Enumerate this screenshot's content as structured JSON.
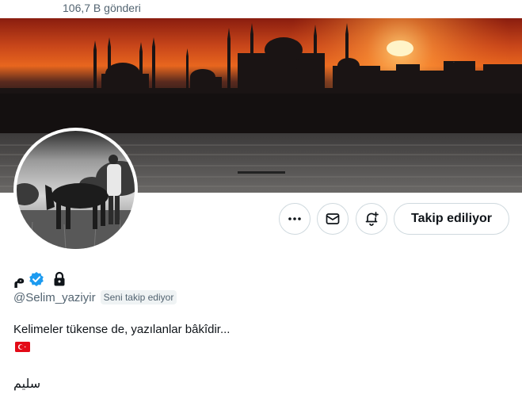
{
  "header": {
    "post_count": "106,7 B gönderi"
  },
  "actions": {
    "more_icon": "more-dots-icon",
    "message_icon": "envelope-icon",
    "notify_icon": "bell-plus-icon",
    "follow_label": "Takip ediliyor"
  },
  "profile": {
    "display_name": "م",
    "verified_icon": "verified-badge-icon",
    "protected_icon": "lock-icon",
    "handle": "@Selim_yaziyir",
    "follows_you_label": "Seni takip ediyor",
    "bio_line1": "Kelimeler tükense de, yazılanlar bâkîdir...",
    "bio_flag": "turkey-flag-icon",
    "bio_arabic": "سليم"
  },
  "colors": {
    "accent": "#1d9bf0",
    "text_primary": "#0f1419",
    "text_secondary": "#536471",
    "border": "#cfd9de"
  }
}
